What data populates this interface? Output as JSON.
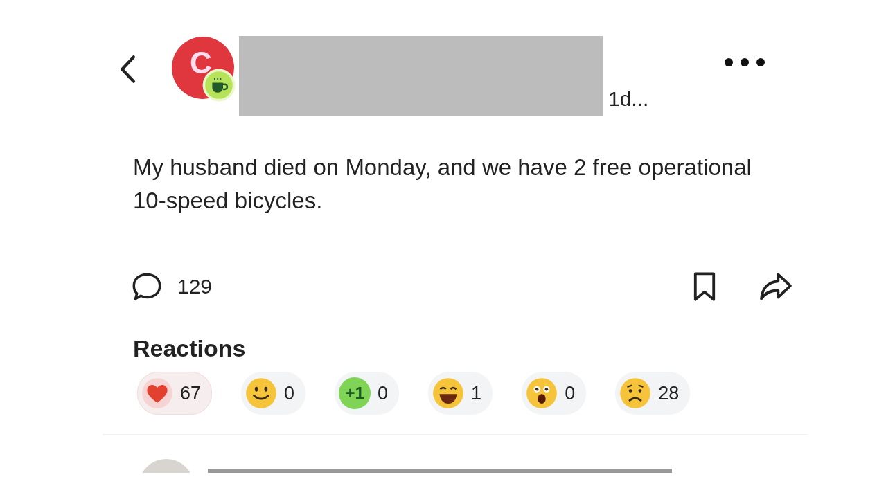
{
  "post": {
    "avatar_letter": "C",
    "time": "1d...",
    "text": "My husband died on Monday, and we have 2 free operational 10-speed bicycles.",
    "comment_count": "129"
  },
  "reactions_title": "Reactions",
  "reactions": [
    {
      "kind": "heart",
      "count": "67",
      "selected": true
    },
    {
      "kind": "smile",
      "count": "0",
      "selected": false
    },
    {
      "kind": "plus_one",
      "label": "+1",
      "count": "0",
      "selected": false
    },
    {
      "kind": "grin",
      "count": "1",
      "selected": false
    },
    {
      "kind": "shocked",
      "count": "0",
      "selected": false
    },
    {
      "kind": "worried",
      "count": "28",
      "selected": false
    }
  ]
}
